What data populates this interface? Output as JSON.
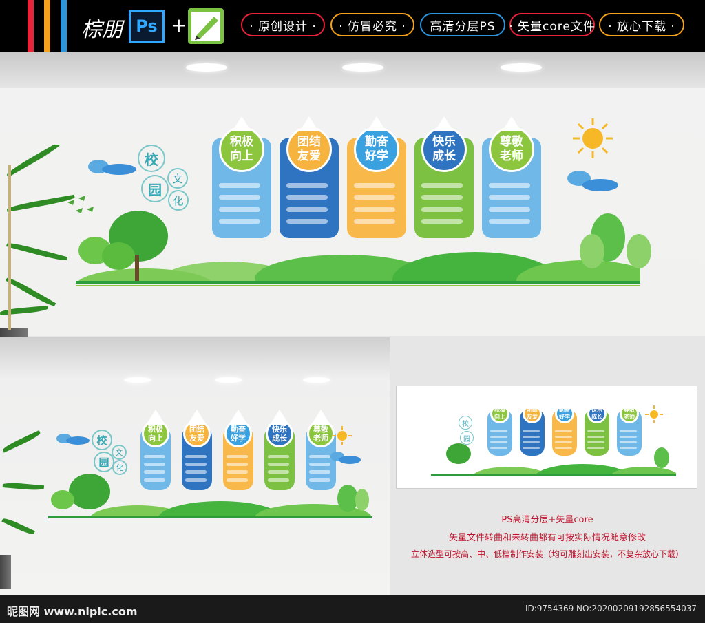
{
  "header": {
    "brand_signature": "棕朋",
    "ps_logo": "Ps",
    "plus": "+",
    "tags": [
      "· 原创设计 ·",
      "· 仿冒必究 ·",
      "高清分层PS",
      "· 矢量core文件",
      "· 放心下载 ·"
    ],
    "tag_colors": [
      "#e8233a",
      "#f4a11d",
      "#2d95dc",
      "#e8233a",
      "#f4a11d"
    ],
    "stripe_colors": [
      "#e8233a",
      "#f4a11d",
      "#2d95dc"
    ]
  },
  "scene": {
    "title_chars": [
      "校",
      "园",
      "文",
      "化"
    ],
    "cards": [
      {
        "title": "积极\n向上",
        "drop_color": "#8cc63f",
        "card_color": "#6fb8e8"
      },
      {
        "title": "团结\n友爱",
        "drop_color": "#f6b33d",
        "card_color": "#2f74c0"
      },
      {
        "title": "勤奋\n好学",
        "drop_color": "#3aa1e0",
        "card_color": "#f8b94a"
      },
      {
        "title": "快乐\n成长",
        "drop_color": "#2f74c0",
        "card_color": "#7cc142"
      },
      {
        "title": "尊敬\n老师",
        "drop_color": "#8cc63f",
        "card_color": "#6fb8e8"
      }
    ]
  },
  "captions": [
    "PS高清分层+矢量core",
    "矢量文件转曲和未转曲都有可按实际情况随意修改",
    "立体造型可按高、中、低档制作安装（均可雕刻出安装，不复杂放心下载）"
  ],
  "footer": {
    "site": "昵图网 www.nipic.com",
    "id": "ID:9754369 NO:20200209192856554037"
  }
}
